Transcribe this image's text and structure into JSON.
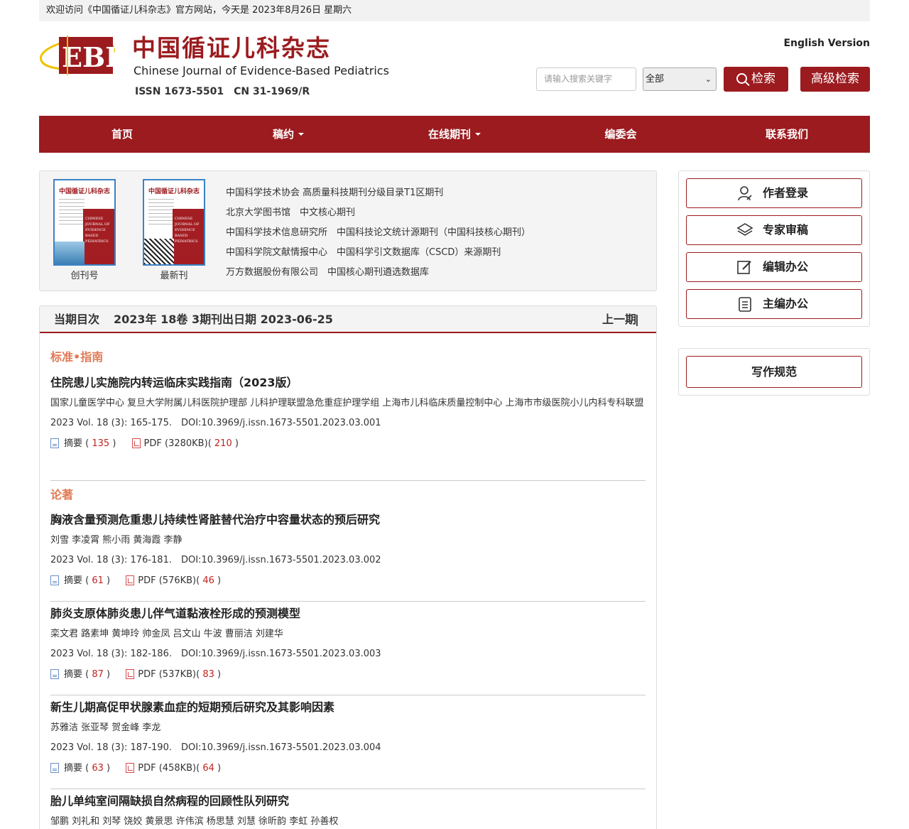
{
  "topbar": {
    "welcome": "欢迎访问《中国循证儿科杂志》官方网站，今天是 2023年8月26日 星期六"
  },
  "header": {
    "logo_title_cn": "中国循证儿科杂志",
    "logo_title_en": "Chinese Journal of Evidence-Based Pediatrics",
    "logo_letters": "EBP",
    "issn": "ISSN 1673-5501　CN 31-1969/R",
    "english_version": "English Version",
    "search_placeholder": "请输入搜索关键字",
    "search_scope": "全部",
    "search_button": "检索",
    "advanced_search_button": "高级检索"
  },
  "nav": {
    "items": [
      {
        "label": "首页",
        "dropdown": false
      },
      {
        "label": "稿约",
        "dropdown": true
      },
      {
        "label": "在线期刊",
        "dropdown": true
      },
      {
        "label": "编委会",
        "dropdown": false
      },
      {
        "label": "联系我们",
        "dropdown": false
      }
    ]
  },
  "covers": {
    "first": {
      "label": "创刊号",
      "cover_title": "中国循证儿科杂志",
      "cover_en": "CHINESE JOURNAL OF EVIDENCE BASED PEDIATRICS"
    },
    "latest": {
      "label": "最新刊",
      "cover_title": "中国循证儿科杂志",
      "cover_en": "CHINESE JOURNAL OF EVIDENCE BASED PEDIATRICS"
    }
  },
  "indexing": [
    "中国科学技术协会 高质量科技期刊分级目录T1区期刊",
    "北京大学图书馆　中文核心期刊",
    "中国科学技术信息研究所　中国科技论文统计源期刊（中国科技核心期刊）",
    "中国科学院文献情报中心　中国科学引文数据库（CSCD）来源期刊",
    "万方数据股份有限公司　中国核心期刊遴选数据库"
  ],
  "toc": {
    "label": "当期目次",
    "issue": "2023年 18卷 3期",
    "date": "刊出日期 2023-06-25",
    "prev": "上一期",
    "sep": "|",
    "sections": [
      {
        "title": "标准•指南"
      },
      {
        "title": "论著"
      }
    ],
    "articles": [
      {
        "title": "住院患儿实施院内转运临床实践指南（2023版）",
        "authors": "国家儿童医学中心 复旦大学附属儿科医院护理部 儿科护理联盟急危重症护理学组 上海市儿科临床质量控制中心 上海市市级医院小儿内科专科联盟",
        "cite": "2023 Vol. 18 (3): 165-175.　DOI:10.3969/j.issn.1673-5501.2023.03.001",
        "abstract_label": "摘要",
        "abstract_count": "135",
        "pdf_label": "PDF (3280KB)",
        "pdf_count": "210"
      },
      {
        "title": "胸液含量预测危重患儿持续性肾脏替代治疗中容量状态的预后研究",
        "authors": "刘雪 李凌霄 熊小雨 黄海霞 李静",
        "cite": "2023 Vol. 18 (3): 176-181.　DOI:10.3969/j.issn.1673-5501.2023.03.002",
        "abstract_label": "摘要",
        "abstract_count": "61",
        "pdf_label": "PDF (576KB)",
        "pdf_count": "46"
      },
      {
        "title": "肺炎支原体肺炎患儿伴气道黏液栓形成的预测模型",
        "authors": "栾文君 路素坤 黄坤玲 帅金凤 吕文山 牛波 曹丽洁 刘建华",
        "cite": "2023 Vol. 18 (3): 182-186.　DOI:10.3969/j.issn.1673-5501.2023.03.003",
        "abstract_label": "摘要",
        "abstract_count": "87",
        "pdf_label": "PDF (537KB)",
        "pdf_count": "83"
      },
      {
        "title": "新生儿期高促甲状腺素血症的短期预后研究及其影响因素",
        "authors": "苏雅洁 张亚琴 贺金峰 李龙",
        "cite": "2023 Vol. 18 (3): 187-190.　DOI:10.3969/j.issn.1673-5501.2023.03.004",
        "abstract_label": "摘要",
        "abstract_count": "63",
        "pdf_label": "PDF (458KB)",
        "pdf_count": "64"
      },
      {
        "title": "胎儿单纯室间隔缺损自然病程的回顾性队列研究",
        "authors": "邹鹏 刘礼和 刘琴 饶姣 黄景思 许伟滨 杨思慧 刘慧 徐昕韵 李虹 孙善权"
      }
    ]
  },
  "sidebar": {
    "author_login": "作者登录",
    "expert_review": "专家审稿",
    "editor_office": "编辑办公",
    "chief_editor_office": "主编办公",
    "writing_guide": "写作规范"
  },
  "colors": {
    "brand_red": "#9b1b1f",
    "section_orange": "#e07a55",
    "count_red": "#c0241f"
  }
}
